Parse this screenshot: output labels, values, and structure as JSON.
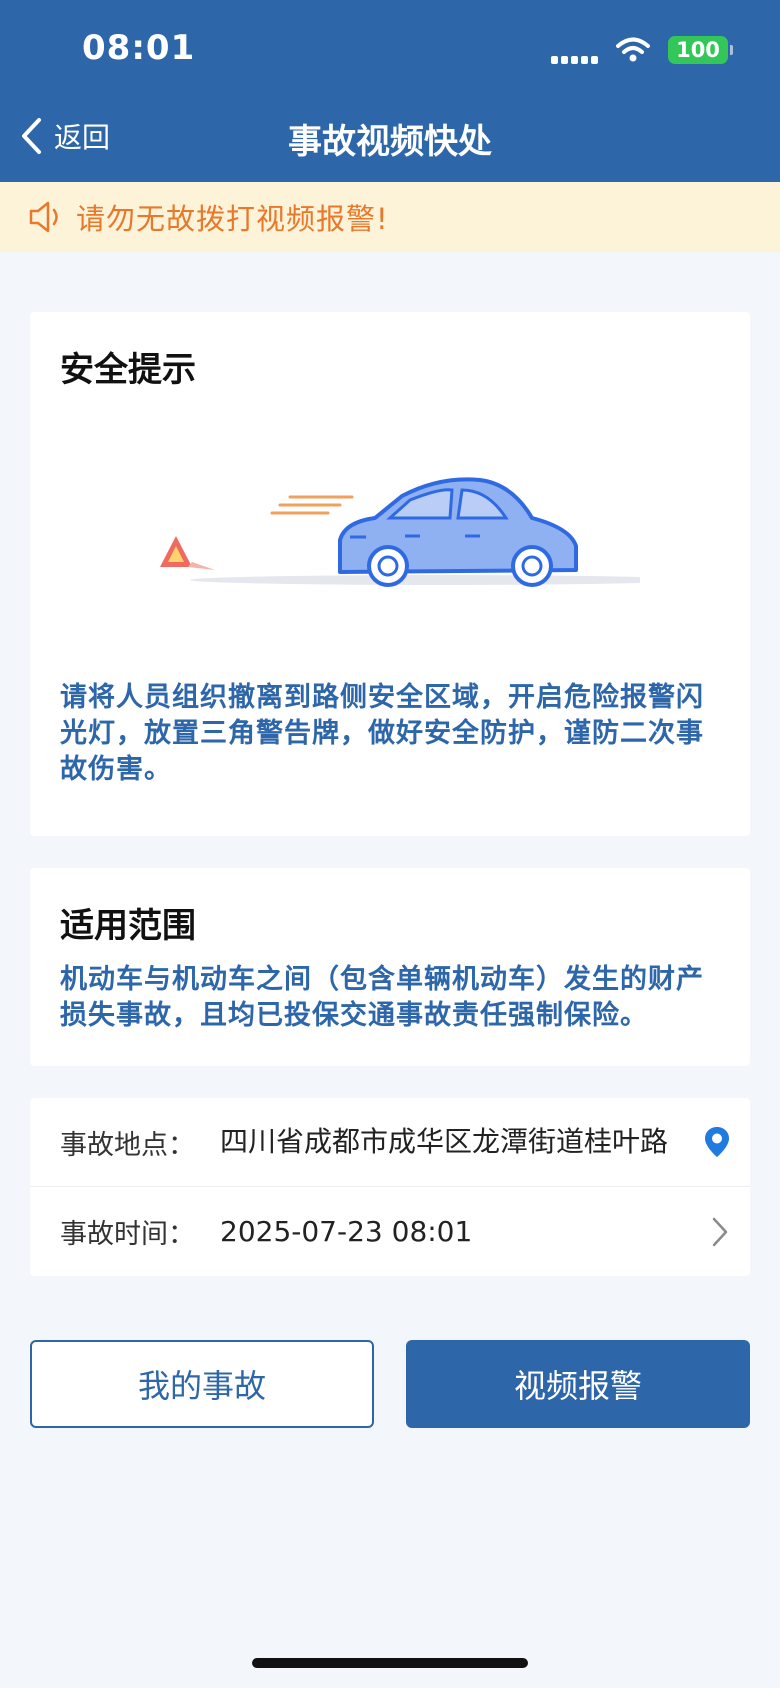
{
  "status_bar": {
    "time": "08:01",
    "battery": "100"
  },
  "nav": {
    "back_label": "返回",
    "title": "事故视频快处"
  },
  "notice": {
    "text": "请勿无故拨打视频报警!"
  },
  "safety": {
    "title": "安全提示",
    "description": "请将人员组织撤离到路侧安全区域，开启危险报警闪光灯，放置三角警告牌，做好安全防护，谨防二次事故伤害。"
  },
  "scope": {
    "title": "适用范围",
    "description": "机动车与机动车之间（包含单辆机动车）发生的财产损失事故，且均已投保交通事故责任强制保险。"
  },
  "form": {
    "location_label": "事故地点：",
    "location_value": "四川省成都市成华区龙潭街道桂叶路",
    "time_label": "事故时间：",
    "time_value": "2025-07-23 08:01"
  },
  "actions": {
    "my_accidents": "我的事故",
    "video_report": "视频报警"
  },
  "colors": {
    "primary": "#2e66aa",
    "notice_bg": "#fcf3d8",
    "notice_text": "#e8792c",
    "battery": "#33c759"
  }
}
